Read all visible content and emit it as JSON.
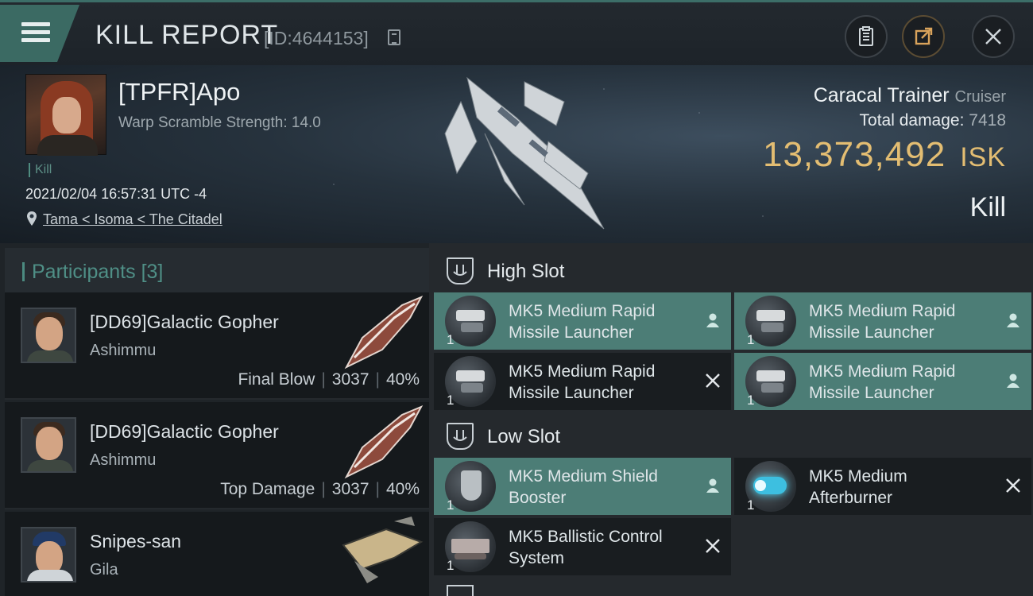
{
  "header": {
    "title": "KILL REPORT",
    "report_id": "[ID:4644153]"
  },
  "victim": {
    "name": "[TPFR]Apo",
    "warp_scramble": "Warp Scramble Strength: 14.0",
    "kill_tag": "Kill",
    "timestamp": "2021/02/04 16:57:31 UTC -4",
    "location": "Tama < Isoma < The Citadel"
  },
  "ship": {
    "name": "Caracal Trainer",
    "class": "Cruiser",
    "total_damage_label": "Total damage:",
    "total_damage": "7418",
    "isk_value": "13,373,492",
    "isk_unit": "ISK",
    "result": "Kill"
  },
  "participants": {
    "label": "Participants",
    "count": "[3]",
    "rows": [
      {
        "name": "[DD69]Galactic Gopher",
        "ship": "Ashimmu",
        "role": "Final Blow",
        "damage": "3037",
        "percent": "40%"
      },
      {
        "name": "[DD69]Galactic Gopher",
        "ship": "Ashimmu",
        "role": "Top Damage",
        "damage": "3037",
        "percent": "40%"
      },
      {
        "name": "Snipes-san",
        "ship": "Gila"
      }
    ]
  },
  "fitting": {
    "high_slot": {
      "label": "High Slot",
      "modules": [
        {
          "line1": "MK5 Medium Rapid",
          "line2": "Missile Launcher",
          "qty": "1",
          "state": "pilot-icon"
        },
        {
          "line1": "MK5 Medium Rapid",
          "line2": "Missile Launcher",
          "qty": "1",
          "state": "pilot-icon"
        },
        {
          "line1": "MK5 Medium Rapid",
          "line2": "Missile Launcher",
          "qty": "1",
          "state": "destroyed-icon"
        },
        {
          "line1": "MK5 Medium Rapid",
          "line2": "Missile Launcher",
          "qty": "1",
          "state": "pilot-icon"
        }
      ]
    },
    "low_slot": {
      "label": "Low Slot",
      "modules": [
        {
          "line1": "MK5 Medium Shield",
          "line2": "Booster",
          "qty": "1",
          "state": "pilot-icon"
        },
        {
          "line1": "MK5 Medium",
          "line2": "Afterburner",
          "qty": "1",
          "state": "destroyed-icon"
        },
        {
          "line1": "MK5 Ballistic Control",
          "line2": "System",
          "qty": "1",
          "state": "destroyed-icon"
        }
      ]
    }
  },
  "colors": {
    "accent": "#4c7d76",
    "isk": "#e3bd72",
    "panel": "#191d20"
  }
}
